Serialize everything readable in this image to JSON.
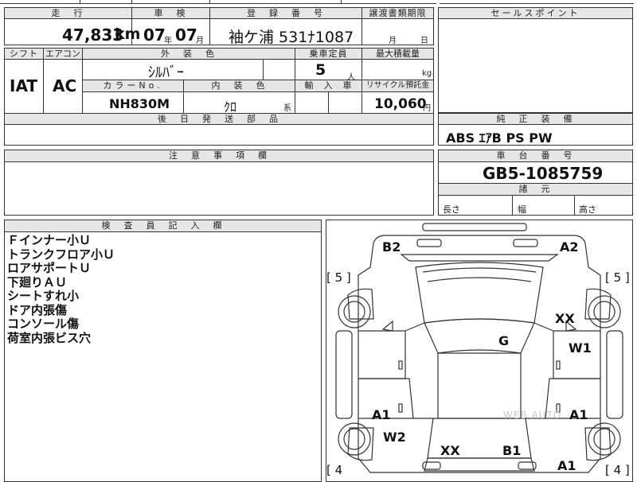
{
  "header": {
    "mileage_label": "走　行",
    "mileage_value": "47,833",
    "mileage_unit": "km",
    "inspection_label": "車　検",
    "inspection_year": "07",
    "inspection_year_unit": "年",
    "inspection_month": "07",
    "inspection_month_unit": "月",
    "registration_label": "登　録　番　号",
    "registration_value": "袖ケ浦 531ﾅ1087",
    "transfer_docs_label": "譲渡書類期限",
    "transfer_month_unit": "月",
    "transfer_day_unit": "日",
    "sales_point_label": "セールスポイント"
  },
  "row2": {
    "shift_label": "シフト",
    "shift_value": "IAT",
    "ac_label": "エアコン",
    "ac_value": "AC",
    "exterior_label": "外　装　色",
    "exterior_value": "ｼﾙﾊﾞｰ",
    "capacity_label": "乗車定員",
    "capacity_value": "5",
    "capacity_unit": "人",
    "max_load_label": "最大積載量",
    "max_load_unit": "kg",
    "color_no_label": "カラーNo.",
    "color_no_value": "NH830M",
    "interior_label": "内　装　色",
    "interior_value": "ｸﾛ",
    "interior_suffix": "系",
    "import_label": "輸　入　車",
    "recycle_label": "リサイクル預託金",
    "recycle_value": "10,060",
    "recycle_unit": "円",
    "later_parts_label": "後　日　発　送　部　品"
  },
  "equipment": {
    "label": "純　正　装　備",
    "value": "ABS ｴｱB PS PW"
  },
  "caution": {
    "label": "注　意　事　項　欄"
  },
  "chassis": {
    "label": "車　台　番　号",
    "value": "GB5-1085759",
    "specs_label": "諸　元",
    "length_label": "長さ",
    "width_label": "幅",
    "height_label": "高さ"
  },
  "inspector": {
    "label": "検　査　員　記　入　欄",
    "notes": [
      "Ｆインナー小Ｕ",
      "トランクフロア小Ｕ",
      "ロアサポートＵ",
      "下廻りＡＵ",
      "シートすれ小",
      "ドア内張傷",
      "コンソール傷",
      "荷室内張ビス穴"
    ]
  },
  "diagram": {
    "tire_fl": "[ 5 ]",
    "tire_fr": "[ 5 ]",
    "tire_rl": "[ 4",
    "tire_rr": "[ 4 ]",
    "marks": {
      "b2": "B2",
      "a2": "A2",
      "xx_top": "XX",
      "g": "G",
      "w1": "W1",
      "a1_left": "A1",
      "a1_right": "A1",
      "w2": "W2",
      "xx_bottom": "XX",
      "b1": "B1",
      "a1_bottom": "A1"
    },
    "watermark": "WEB AUTO"
  }
}
